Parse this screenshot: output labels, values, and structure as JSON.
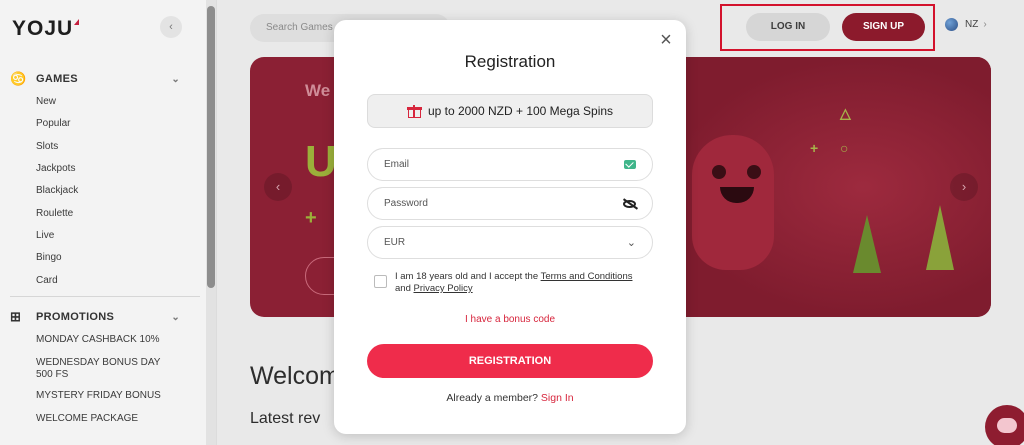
{
  "brand": {
    "logo": "YOJU",
    "accent": "#d7263d",
    "dark_accent": "#8c1a2c"
  },
  "sidebar": {
    "collapse_icon": "‹",
    "games": {
      "label": "GAMES",
      "items": [
        "New",
        "Popular",
        "Slots",
        "Jackpots",
        "Blackjack",
        "Roulette",
        "Live",
        "Bingo",
        "Card"
      ]
    },
    "promotions": {
      "label": "PROMOTIONS",
      "items": [
        "MONDAY CASHBACK 10%",
        "WEDNESDAY BONUS DAY 500 FS",
        "MYSTERY FRIDAY BONUS",
        "WELCOME PACKAGE"
      ]
    }
  },
  "header": {
    "search_placeholder": "Search Games",
    "login_label": "LOG IN",
    "signup_label": "SIGN UP",
    "region": "NZ"
  },
  "banner": {
    "text": "We",
    "big_text": "UI",
    "plus": "+"
  },
  "main": {
    "welcome": "Welcom",
    "latest": "Latest rev"
  },
  "modal": {
    "title": "Registration",
    "close_icon": "×",
    "bonus": "up to 2000 NZD + 100 Mega Spins",
    "email_placeholder": "Email",
    "password_placeholder": "Password",
    "currency": "EUR",
    "terms_prefix": "I am 18 years old and I accept the ",
    "terms_link": "Terms and Conditions",
    "terms_and": " and ",
    "privacy_link": "Privacy Policy",
    "bonus_code": "I have a bonus code",
    "register_label": "REGISTRATION",
    "member_prefix": "Already a member? ",
    "signin_label": "Sign In"
  }
}
